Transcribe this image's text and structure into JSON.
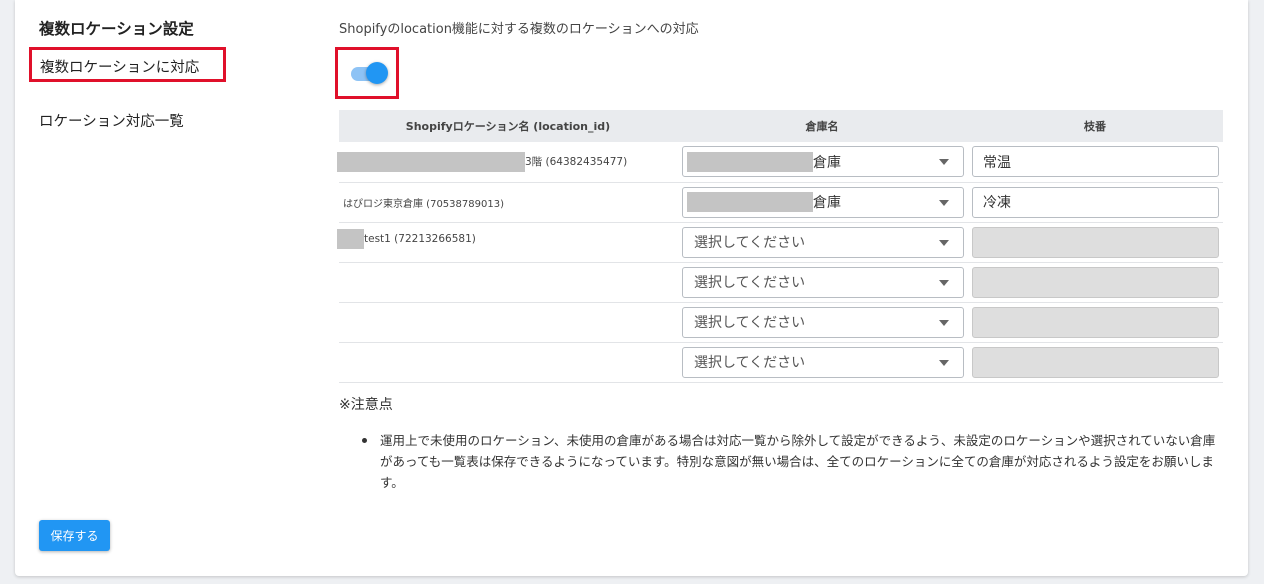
{
  "section": {
    "title": "複数ロケーション設定",
    "multi_location_label": "複数ロケーションに対応",
    "location_list_label": "ロケーション対応一覧"
  },
  "description": "Shopifyのlocation機能に対する複数のロケーションへの対応",
  "toggle": {
    "enabled": true,
    "accent_color": "#2196f3"
  },
  "table": {
    "headers": {
      "location": "Shopifyロケーション名 (location_id)",
      "warehouse": "倉庫名",
      "branch": "枝番"
    },
    "rows": [
      {
        "location_suffix": "3階 (64382435477)",
        "warehouse_suffix": "倉庫",
        "branch_value": "常温"
      },
      {
        "location": "はぴロジ東京倉庫 (70538789013)",
        "warehouse_suffix": "倉庫",
        "branch_value": "冷凍"
      },
      {
        "location_suffix": "test1 (72213266581)",
        "warehouse_placeholder": "選択してください"
      },
      {
        "warehouse_placeholder": "選択してください"
      },
      {
        "warehouse_placeholder": "選択してください"
      },
      {
        "warehouse_placeholder": "選択してください"
      }
    ]
  },
  "notes": {
    "title": "※注意点",
    "items": [
      "運用上で未使用のロケーション、未使用の倉庫がある場合は対応一覧から除外して設定ができるよう、未設定のロケーションや選択されていない倉庫があっても一覧表は保存できるようになっています。特別な意図が無い場合は、全てのロケーションに全ての倉庫が対応されるよう設定をお願いします。"
    ]
  },
  "save_button": {
    "label": "保存する"
  },
  "highlight_color": "#e0102a"
}
